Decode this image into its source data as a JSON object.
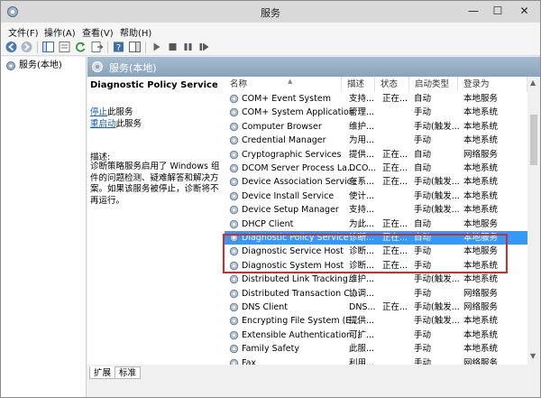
{
  "window": {
    "title": "服务",
    "min_glyph": "—",
    "max_glyph": "☐",
    "close_glyph": "✕"
  },
  "menu": [
    "文件(F)",
    "操作(A)",
    "查看(V)",
    "帮助(H)"
  ],
  "toolbar_icons": [
    "back-arrow-icon",
    "forward-arrow-icon",
    "console-tree-icon",
    "properties-icon",
    "refresh-icon",
    "export-list-icon",
    "help-icon",
    "show-hide-icon",
    "start-service-icon",
    "stop-service-icon",
    "pause-service-icon",
    "restart-service-icon"
  ],
  "tree": {
    "root_label": "服务(本地)"
  },
  "pane": {
    "header": "服务(本地)",
    "selected_service": "Diagnostic Policy Service",
    "stop_link": "停止",
    "stop_suffix": "此服务",
    "restart_link": "重启动",
    "restart_suffix": "此服务",
    "desc_label": "描述:",
    "desc_text": "诊断策略服务启用了 Windows 组件的问题检测、疑难解答和解决方案。如果该服务被停止，诊断将不再运行。"
  },
  "columns": [
    "名称",
    "描述",
    "状态",
    "启动类型",
    "登录为"
  ],
  "services": [
    {
      "name": "COM+ Event System",
      "desc": "支持...",
      "status": "正在...",
      "start": "自动",
      "logon": "本地服务"
    },
    {
      "name": "COM+ System Application",
      "desc": "管理...",
      "status": "",
      "start": "手动",
      "logon": "本地系统"
    },
    {
      "name": "Computer Browser",
      "desc": "维护...",
      "status": "",
      "start": "手动(触发...",
      "logon": "本地系统"
    },
    {
      "name": "Credential Manager",
      "desc": "为用...",
      "status": "",
      "start": "手动",
      "logon": "本地系统"
    },
    {
      "name": "Cryptographic Services",
      "desc": "提供...",
      "status": "正在...",
      "start": "自动",
      "logon": "网络服务"
    },
    {
      "name": "DCOM Server Process La...",
      "desc": "DCO...",
      "status": "正在...",
      "start": "自动",
      "logon": "本地系统"
    },
    {
      "name": "Device Association Service",
      "desc": "在系...",
      "status": "正在...",
      "start": "手动(触发...",
      "logon": "本地系统"
    },
    {
      "name": "Device Install Service",
      "desc": "使计...",
      "status": "",
      "start": "手动(触发...",
      "logon": "本地系统"
    },
    {
      "name": "Device Setup Manager",
      "desc": "支持...",
      "status": "",
      "start": "手动(触发...",
      "logon": "本地系统"
    },
    {
      "name": "DHCP Client",
      "desc": "为此...",
      "status": "正在...",
      "start": "自动",
      "logon": "本地服务"
    },
    {
      "name": "Diagnostic Policy Service",
      "desc": "诊断...",
      "status": "正在...",
      "start": "自动",
      "logon": "本地服务"
    },
    {
      "name": "Diagnostic Service Host",
      "desc": "诊断...",
      "status": "正在...",
      "start": "手动",
      "logon": "本地服务"
    },
    {
      "name": "Diagnostic System Host",
      "desc": "诊断...",
      "status": "正在...",
      "start": "手动",
      "logon": "本地系统"
    },
    {
      "name": "Distributed Link Tracking...",
      "desc": "维护...",
      "status": "",
      "start": "手动(触发...",
      "logon": "本地系统"
    },
    {
      "name": "Distributed Transaction C...",
      "desc": "协调...",
      "status": "",
      "start": "手动",
      "logon": "网络服务"
    },
    {
      "name": "DNS Client",
      "desc": "DNS...",
      "status": "正在...",
      "start": "手动(触发...",
      "logon": "网络服务"
    },
    {
      "name": "Encrypting File System (E...",
      "desc": "提供...",
      "status": "",
      "start": "手动(触发...",
      "logon": "本地系统"
    },
    {
      "name": "Extensible Authentication...",
      "desc": "可扩...",
      "status": "",
      "start": "手动",
      "logon": "本地系统"
    },
    {
      "name": "Family Safety",
      "desc": "此服...",
      "status": "",
      "start": "手动",
      "logon": "本地系统"
    },
    {
      "name": "Fax",
      "desc": "利用...",
      "status": "",
      "start": "手动",
      "logon": "网络服务"
    }
  ],
  "selected_index": 10,
  "tabs": [
    "扩展",
    "标准"
  ],
  "colors": {
    "header_blue": "#8aa3bb",
    "selection": "#3399ff",
    "highlight_border": "#d42a2a",
    "link": "#1a5fb4"
  }
}
